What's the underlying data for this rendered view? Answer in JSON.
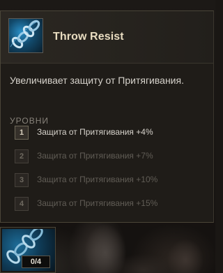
{
  "skill": {
    "title": "Throw Resist",
    "icon": "chain-icon",
    "description": "Увеличивает защиту от Притягивания."
  },
  "levels_section": {
    "label": "УРОВНИ",
    "items": [
      {
        "number": "1",
        "text": "Защита от Притягивания +4%",
        "active": true
      },
      {
        "number": "2",
        "text": "Защита от Притягивания +7%",
        "active": false
      },
      {
        "number": "3",
        "text": "Защита от Притягивания +10%",
        "active": false
      },
      {
        "number": "4",
        "text": "Защита от Притягивания +15%",
        "active": false
      }
    ]
  },
  "slot": {
    "icon": "chain-icon",
    "counter": "0/4"
  },
  "colors": {
    "title": "#e8dcc0",
    "active_text": "#d6d2cb",
    "inactive_text": "#615d56",
    "border": "#4a4538"
  }
}
